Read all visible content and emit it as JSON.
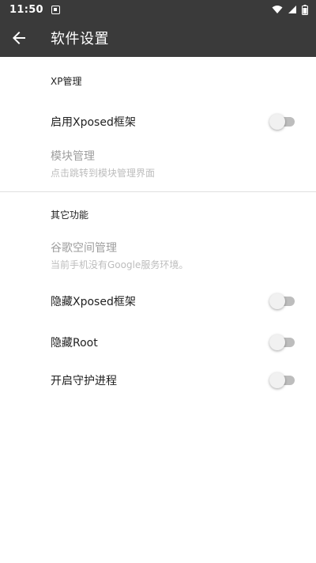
{
  "status_bar": {
    "time": "11:50",
    "icons": [
      "notification-icon",
      "wifi-icon",
      "signal-icon",
      "battery-icon"
    ]
  },
  "app_bar": {
    "title": "软件设置",
    "back_icon": "arrow-back-icon"
  },
  "colors": {
    "app_bar": "#3a3a3a",
    "background": "#ffffff",
    "primary_text": "#212121",
    "disabled_text": "#9e9e9e",
    "switch_off_track": "#bdbdbd",
    "switch_off_thumb": "#f1f1f1"
  },
  "sections": {
    "xp": {
      "header": "XP管理",
      "enable_xposed": {
        "title": "启用Xposed框架",
        "checked": false
      },
      "module_manage": {
        "title": "模块管理",
        "summary": "点击跳转到模块管理界面",
        "enabled": false
      }
    },
    "other": {
      "header": "其它功能",
      "google_space": {
        "title": "谷歌空间管理",
        "summary": "当前手机没有Google服务环境。",
        "enabled": false
      },
      "hide_xposed": {
        "title": "隐藏Xposed框架",
        "checked": false
      },
      "hide_root": {
        "title": "隐藏Root",
        "checked": false
      },
      "guard_process": {
        "title": "开启守护进程",
        "checked": false
      }
    }
  }
}
